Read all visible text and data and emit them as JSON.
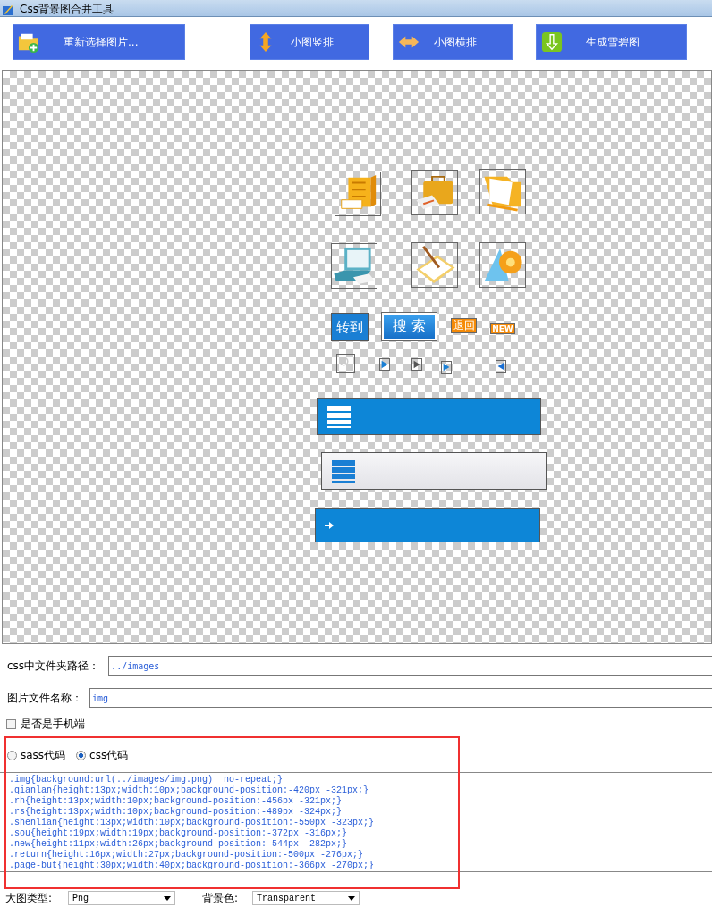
{
  "window": {
    "title": "Css背景图合并工具"
  },
  "toolbar": [
    {
      "label": "重新选择图片...",
      "kind": "add-folder"
    },
    {
      "label": "小图竖排",
      "kind": "vertical"
    },
    {
      "label": "小图横排",
      "kind": "horizontal"
    },
    {
      "label": "生成雪碧图",
      "kind": "download"
    }
  ],
  "canvas": {
    "sprites": [
      {
        "kind": "cabinet"
      },
      {
        "kind": "briefcase"
      },
      {
        "kind": "folder"
      },
      {
        "kind": "laptop"
      },
      {
        "kind": "notebook"
      },
      {
        "kind": "ruler"
      },
      {
        "kind": "blue-label",
        "text": "转到"
      },
      {
        "kind": "search-label",
        "text": "搜 索"
      },
      {
        "kind": "orange-label",
        "text": "退回"
      },
      {
        "kind": "new-label",
        "text": "NEW"
      },
      {
        "kind": "magnifier"
      },
      {
        "kind": "arrow-right"
      },
      {
        "kind": "arrow-grey"
      },
      {
        "kind": "arrow-right"
      },
      {
        "kind": "arrow-left"
      },
      {
        "kind": "blue-bar"
      },
      {
        "kind": "grey-bar"
      },
      {
        "kind": "arrow-bar"
      }
    ]
  },
  "form": {
    "path": {
      "label": "css中文件夹路径：",
      "value": "../images"
    },
    "filename": {
      "label": "图片文件名称：",
      "value": "img"
    },
    "mobile": {
      "label": "是否是手机端",
      "checked": false
    },
    "modes": [
      {
        "label": "sass代码",
        "selected": false
      },
      {
        "label": "css代码",
        "selected": true
      }
    ],
    "code": [
      ".img{background:url(../images/img.png)  no-repeat;}",
      ".qianlan{height:13px;width:10px;background-position:-420px -321px;}",
      ".rh{height:13px;width:10px;background-position:-456px -321px;}",
      ".rs{height:13px;width:10px;background-position:-489px -324px;}",
      ".shenlian{height:13px;width:10px;background-position:-550px -323px;}",
      ".sou{height:19px;width:19px;background-position:-372px -316px;}",
      ".new{height:11px;width:26px;background-position:-544px -282px;}",
      ".return{height:16px;width:27px;background-position:-500px -276px;}",
      ".page-but{height:30px;width:40px;background-position:-366px -270px;}"
    ],
    "image_type": {
      "label": "大图类型:",
      "value": "Png"
    },
    "bg_color": {
      "label": "背景色:",
      "value": "Transparent"
    }
  }
}
